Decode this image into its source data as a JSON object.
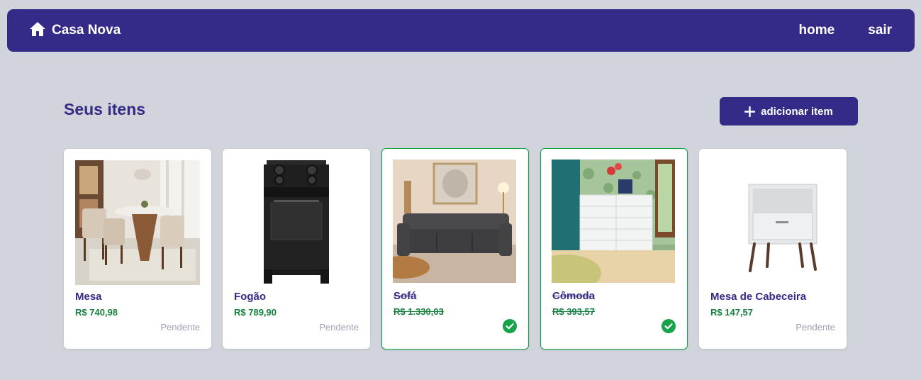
{
  "navbar": {
    "brand_icon": "home-icon",
    "brand_name": "Casa Nova",
    "links": [
      "home",
      "sair"
    ],
    "color": "#332b87"
  },
  "main": {
    "title": "Seus itens",
    "add_button": {
      "icon": "plus-icon",
      "label": "adicionar item"
    }
  },
  "items": [
    {
      "name": "Mesa",
      "price": "R$ 740,98",
      "status": "Pendente",
      "purchased": false,
      "image": "dining-table-photo"
    },
    {
      "name": "Fogão",
      "price": "R$ 789,90",
      "status": "Pendente",
      "purchased": false,
      "image": "stove-photo"
    },
    {
      "name": "Sofá",
      "price": "R$ 1.330,03",
      "status": "",
      "purchased": true,
      "image": "sofa-photo"
    },
    {
      "name": "Cômoda",
      "price": "R$ 393,57",
      "status": "",
      "purchased": true,
      "image": "dresser-photo"
    },
    {
      "name": "Mesa de Cabeceira",
      "price": "R$ 147,57",
      "status": "Pendente",
      "purchased": false,
      "image": "nightstand-photo"
    }
  ],
  "colors": {
    "primary": "#332b87",
    "price": "#15803d",
    "done_border": "#16a34a",
    "check": "#16a34a",
    "status_text": "#9ca3af",
    "background": "#d1d5db"
  }
}
